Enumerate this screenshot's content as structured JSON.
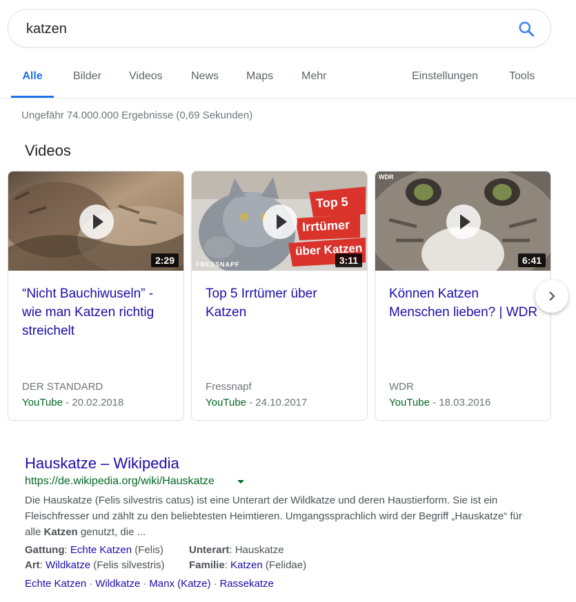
{
  "search": {
    "query": "katzen"
  },
  "tabs": [
    {
      "label": "Alle",
      "active": true
    },
    {
      "label": "Bilder"
    },
    {
      "label": "Videos"
    },
    {
      "label": "News"
    },
    {
      "label": "Maps"
    },
    {
      "label": "Mehr"
    },
    {
      "label": "Einstellungen"
    },
    {
      "label": "Tools"
    }
  ],
  "stats": "Ungefähr 74.000.000 Ergebnisse (0,69 Sekunden)",
  "videos": {
    "heading": "Videos",
    "items": [
      {
        "duration": "2:29",
        "title": "“Nicht Bauchiwuseln” - wie man Katzen richtig streichelt",
        "source": "DER STANDARD",
        "platform": "YouTube",
        "date": " - 20.02.2018"
      },
      {
        "duration": "3:11",
        "title": "Top 5 Irrtümer über Katzen",
        "source": "Fressnapf",
        "platform": "YouTube",
        "date": " - 24.10.2017",
        "overlay": [
          "Top 5",
          "Irrtümer",
          "über Katzen"
        ],
        "watermark": "FRESSNAPF"
      },
      {
        "duration": "6:41",
        "title": "Können Katzen Menschen lieben? | WDR",
        "source": "WDR",
        "platform": "YouTube",
        "date": " - 18.03.2016",
        "watermark": "WDR"
      }
    ]
  },
  "wikipedia": {
    "title": "Hauskatze – Wikipedia",
    "url": "https://de.wikipedia.org/wiki/Hauskatze",
    "snippet_1": "Die Hauskatze (Felis silvestris catus) ist eine Unterart der Wildkatze und deren Haustierform. Sie ist ein Fleischfresser und zählt zu den beliebtesten Heimtieren. Umgangssprachlich wird der Begriff „Hauskatze“ für alle ",
    "snippet_bold": "Katzen",
    "snippet_2": " genutzt, die ...",
    "attributes": {
      "gattung_label": "Gattung",
      "gattung_link": "Echte Katzen",
      "gattung_extra": " (Felis)",
      "art_label": "Art",
      "art_link": "Wildkatze",
      "art_extra": " (Felis silvestris)",
      "unterart_label": "Unterart",
      "unterart_value": " Hauskatze",
      "familie_label": "Familie",
      "familie_link": "Katzen",
      "familie_extra": " (Felidae)"
    },
    "related": [
      "Echte Katzen",
      "Wildkatze",
      "Manx (Katze)",
      "Rassekatze"
    ]
  }
}
